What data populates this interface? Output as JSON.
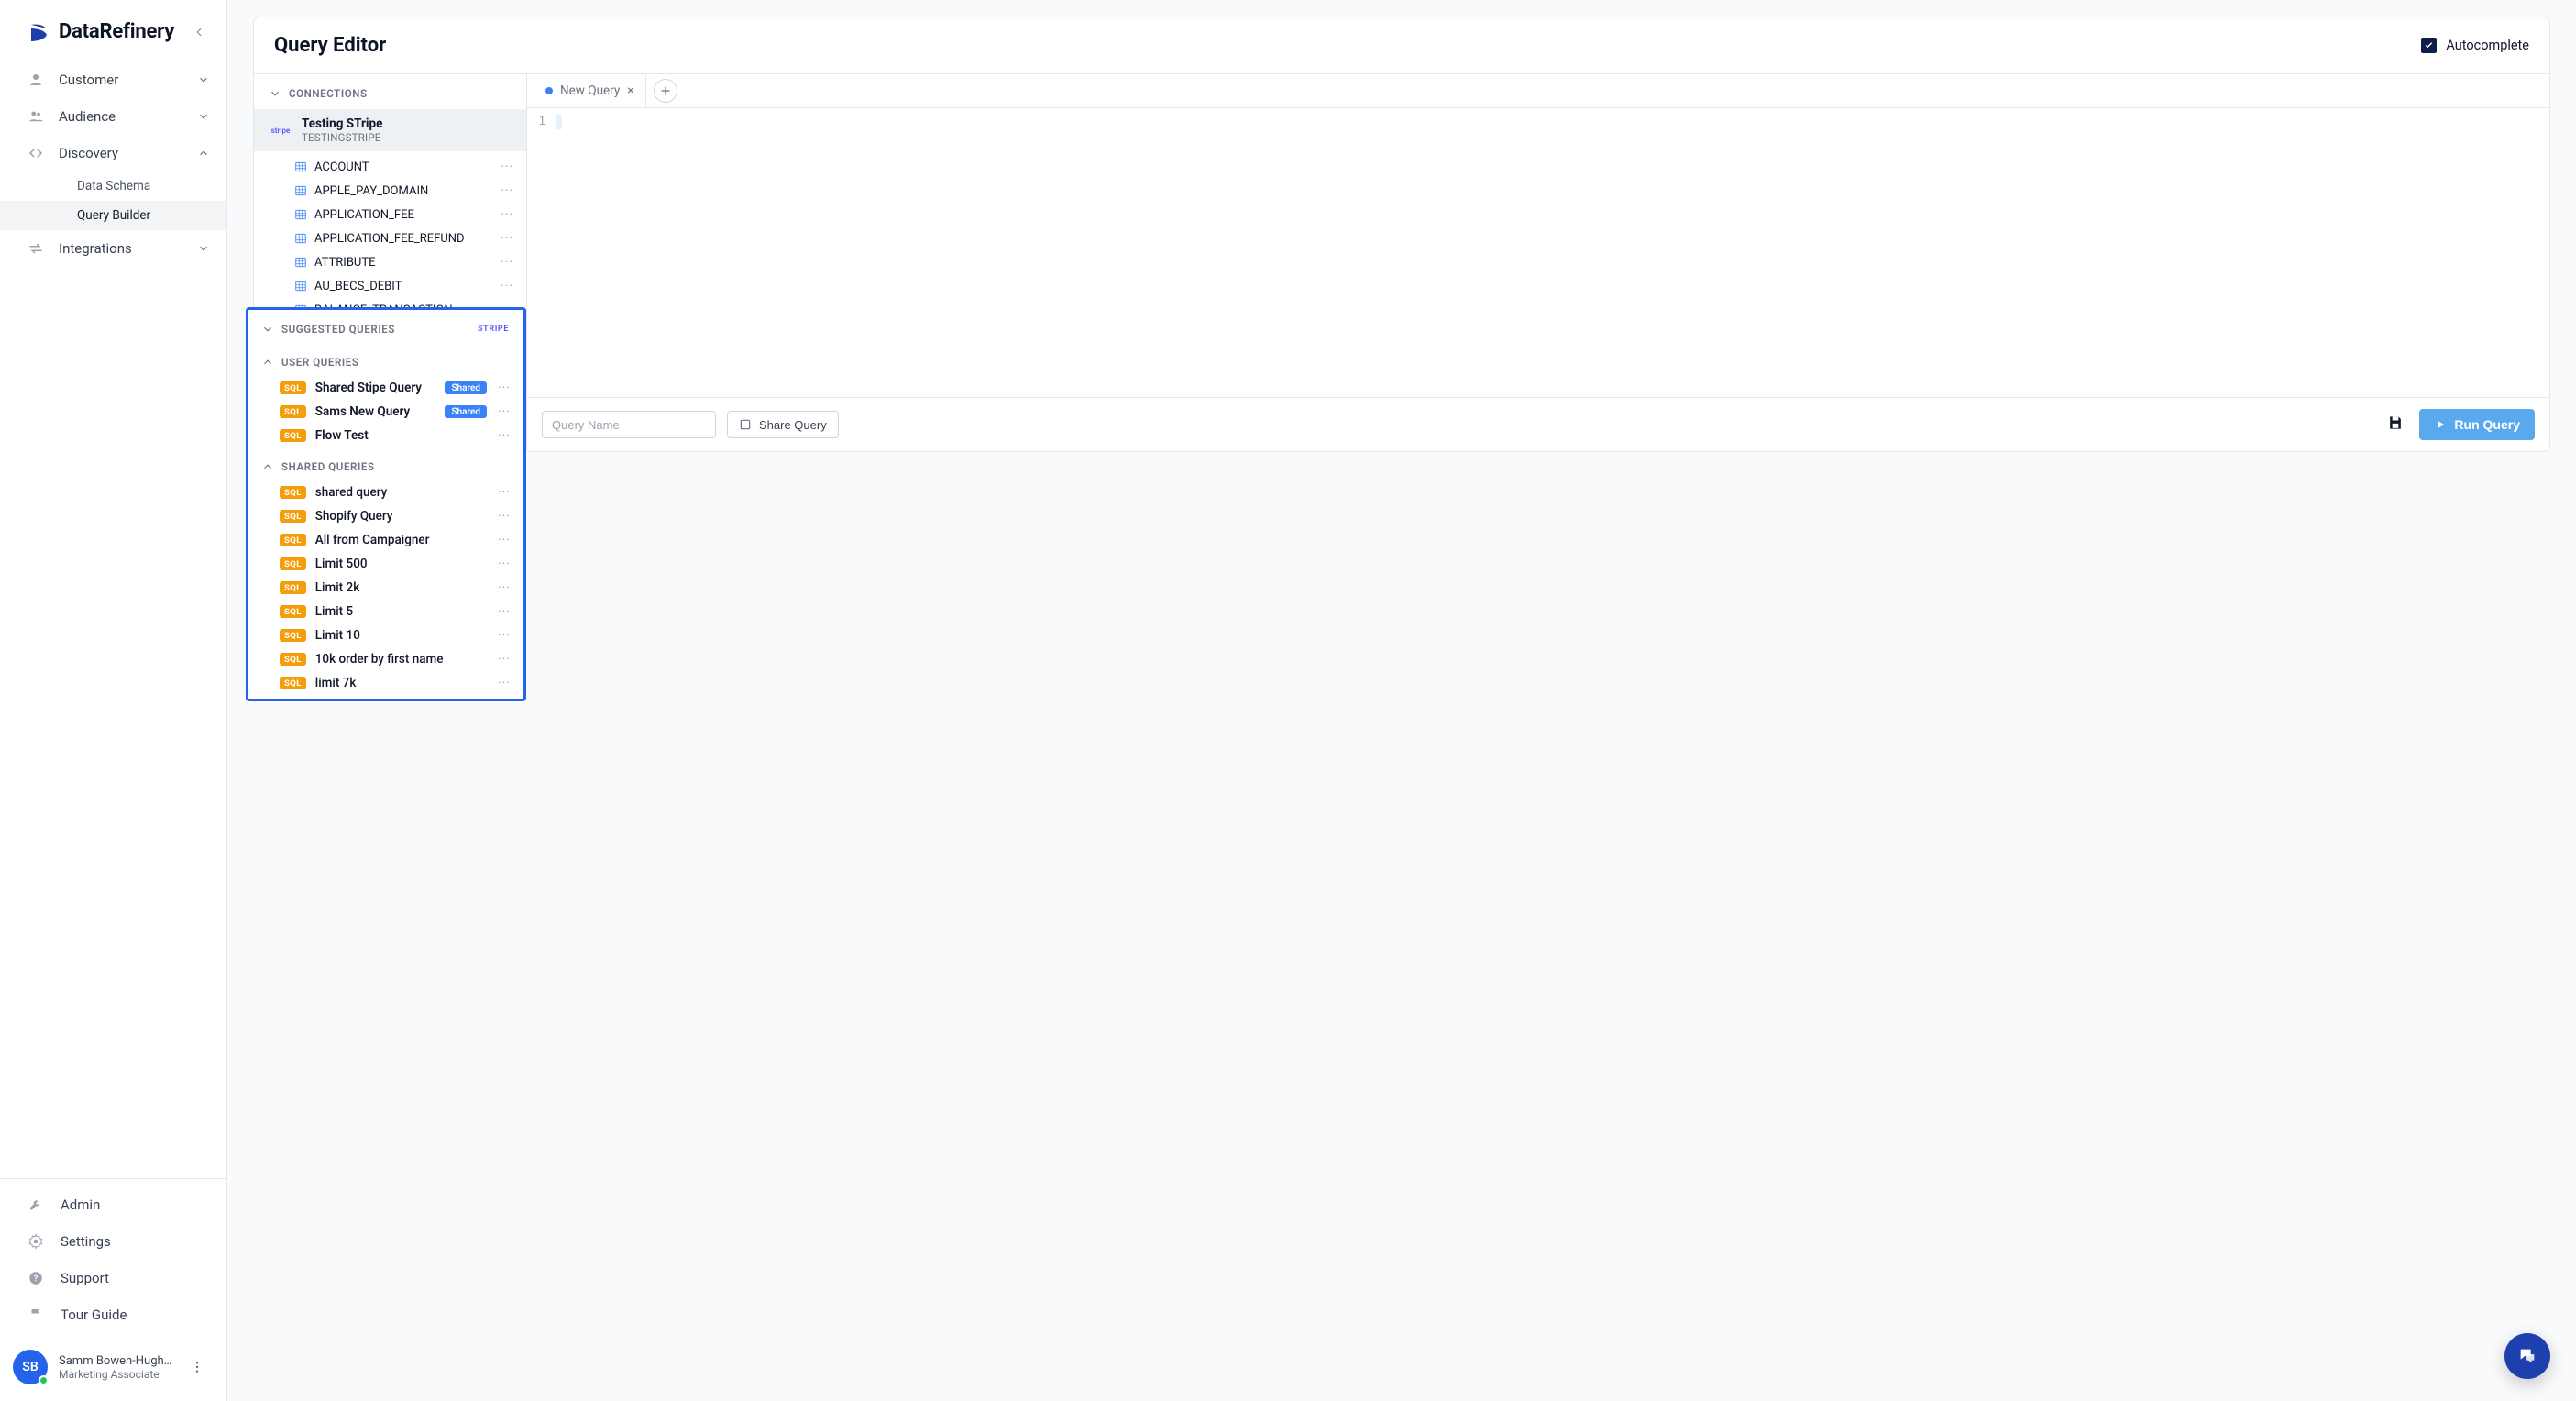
{
  "brand": {
    "name": "DataRefinery"
  },
  "sidebar": {
    "items": [
      {
        "label": "Customer"
      },
      {
        "label": "Audience"
      },
      {
        "label": "Discovery"
      },
      {
        "label": "Integrations"
      }
    ],
    "discovery_sub": [
      {
        "label": "Data Schema"
      },
      {
        "label": "Query Builder"
      }
    ],
    "bottom": [
      {
        "label": "Admin"
      },
      {
        "label": "Settings"
      },
      {
        "label": "Support"
      },
      {
        "label": "Tour Guide"
      }
    ]
  },
  "user": {
    "initials": "SB",
    "name": "Samm Bowen-Hughes",
    "title": "Marketing Associate"
  },
  "header": {
    "title": "Query Editor",
    "autocomplete_label": "Autocomplete",
    "autocomplete_checked": true
  },
  "explorer": {
    "connections_label": "CONNECTIONS",
    "connection": {
      "logo_text": "stripe",
      "name": "Testing STripe",
      "sub": "TESTINGSTRIPE"
    },
    "tables": [
      "ACCOUNT",
      "APPLE_PAY_DOMAIN",
      "APPLICATION_FEE",
      "APPLICATION_FEE_REFUND",
      "ATTRIBUTE",
      "AU_BECS_DEBIT",
      "BALANCE_TRANSACTION"
    ]
  },
  "editor": {
    "tab_label": "New Query",
    "line_numbers": [
      "1"
    ],
    "query_name_placeholder": "Query Name",
    "share_label": "Share Query",
    "run_label": "Run Query"
  },
  "queries_panel": {
    "suggested_label": "SUGGESTED QUERIES",
    "stripe_chip": "stripe",
    "user_queries_label": "USER QUERIES",
    "shared_queries_label": "SHARED QUERIES",
    "sql_badge": "SQL",
    "shared_chip": "Shared",
    "user_queries": [
      {
        "name": "Shared Stipe Query",
        "shared": true
      },
      {
        "name": "Sams New Query",
        "shared": true
      },
      {
        "name": "Flow Test",
        "shared": false
      }
    ],
    "shared_queries": [
      {
        "name": "shared query"
      },
      {
        "name": "Shopify Query"
      },
      {
        "name": "All from Campaigner"
      },
      {
        "name": "Limit 500"
      },
      {
        "name": "Limit 2k"
      },
      {
        "name": "Limit 5"
      },
      {
        "name": "Limit 10"
      },
      {
        "name": "10k order by first name"
      },
      {
        "name": "limit 7k"
      }
    ]
  }
}
